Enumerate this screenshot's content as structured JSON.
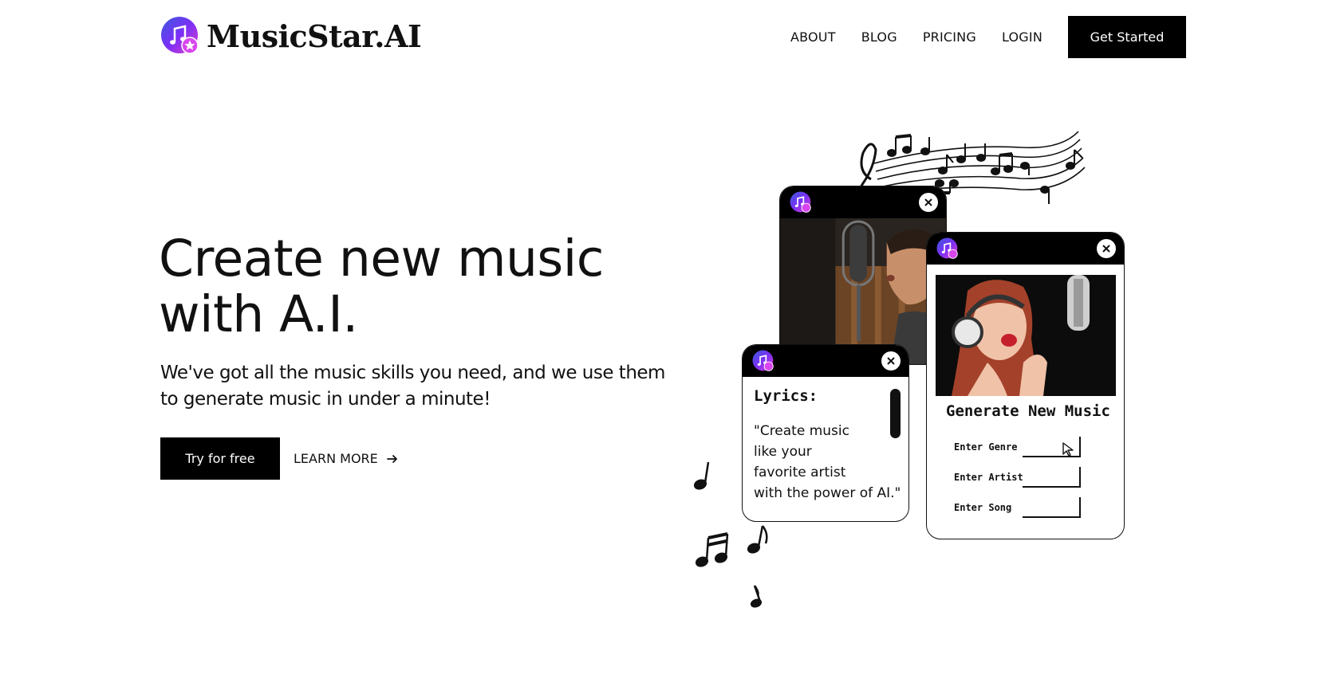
{
  "header": {
    "brand": "MusicStar.AI",
    "nav": [
      "ABOUT",
      "BLOG",
      "PRICING",
      "LOGIN"
    ],
    "cta_label": "Get Started"
  },
  "hero": {
    "title_lines": [
      "Create new music",
      "with A.I."
    ],
    "subtitle_lines": [
      "We've got all the music skills you need, and we use them",
      "to generate music in under a minute!"
    ],
    "primary_cta": "Try for free",
    "secondary_cta": "LEARN MORE"
  },
  "illustration": {
    "lyrics_card": {
      "heading": "Lyrics:",
      "lines": [
        "\"Create music",
        " like your",
        " favorite artist",
        " with the power of AI.\""
      ]
    },
    "generate_card": {
      "heading": "Generate New Music",
      "fields": [
        {
          "label": "Enter Genre"
        },
        {
          "label": "Enter Artist"
        },
        {
          "label": "Enter Song"
        }
      ]
    }
  },
  "colors": {
    "accent_purple": "#7b2ff7",
    "accent_pink": "#e040c8",
    "dark": "#000000"
  },
  "icons": [
    "logo-icon",
    "arrow-right-icon",
    "close-icon",
    "cursor-icon",
    "music-note-icon"
  ]
}
